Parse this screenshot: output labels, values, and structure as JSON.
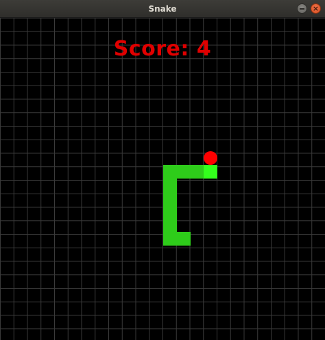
{
  "window": {
    "title": "Snake",
    "controls": [
      "minimize-icon",
      "close-icon"
    ],
    "close_glyph": "×"
  },
  "game": {
    "score_text": "Score: 4",
    "score": 4,
    "colors": {
      "background": "#000000",
      "grid": "#3a3a3a",
      "snake_body": "#2ecc1a",
      "snake_head": "#33ff1c",
      "apple": "#ff0000",
      "score": "#e00000"
    }
  }
}
